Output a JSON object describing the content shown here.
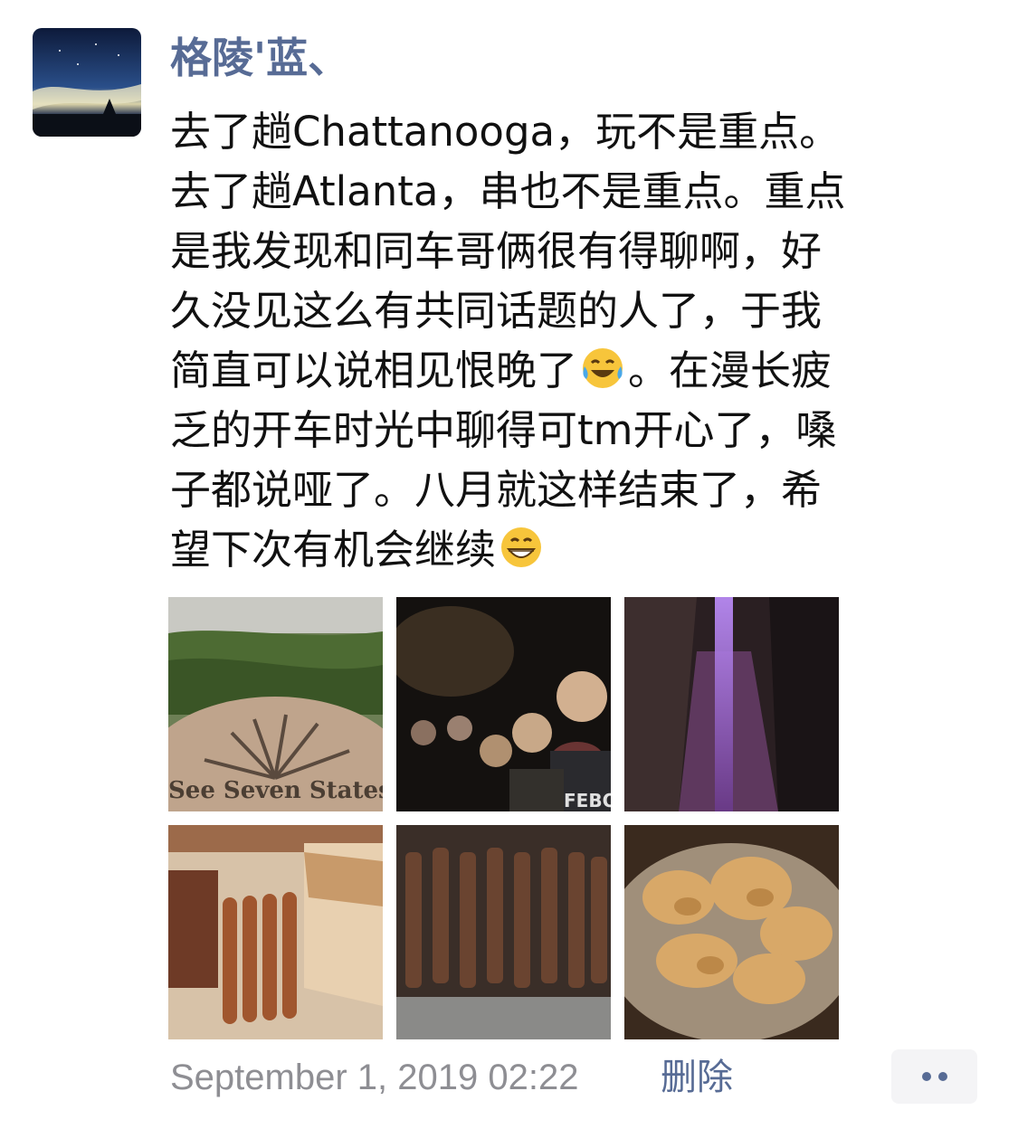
{
  "author": {
    "name": "格陵'蓝、"
  },
  "post": {
    "lines": [
      "去了趟Chattanooga，玩不是重点。",
      "去了趟Atlanta，串也不是重点。重点",
      "是我发现和同车哥俩很有得聊啊，好",
      "久没见这么有共同话题的人了，于我",
      {
        "before": "简直可以说相见恨晚了",
        "emoji": "tears-of-joy-emoji",
        "after": "。在漫长疲"
      },
      "乏的开车时光中聊得可tm开心了，嗓",
      "子都说哑了。八月就这样结束了，希",
      {
        "before": "望下次有机会继续",
        "emoji": "grinning-emoji",
        "after": ""
      }
    ],
    "photos": [
      {
        "name": "photo-see-seven-states",
        "label": "See Seven States"
      },
      {
        "name": "photo-cave-group-selfie",
        "label": "FEBO"
      },
      {
        "name": "photo-purple-waterfall"
      },
      {
        "name": "photo-skewers-sausage"
      },
      {
        "name": "photo-skewers-lamb"
      },
      {
        "name": "photo-skewers-chicken"
      }
    ]
  },
  "footer": {
    "timestamp": "September 1, 2019 02:22",
    "delete_label": "删除",
    "more_icon": "more-dots-icon"
  },
  "colors": {
    "link": "#576b95",
    "text": "#111111",
    "muted": "#8e8e93",
    "button_bg": "#f4f4f6"
  }
}
